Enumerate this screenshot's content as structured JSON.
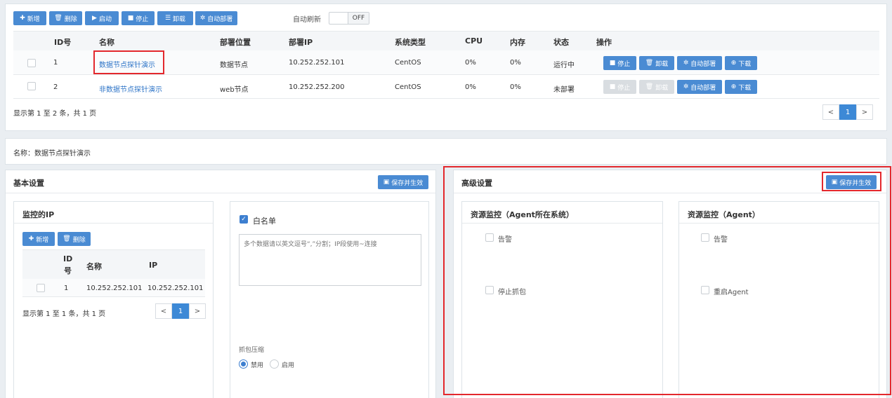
{
  "toolbar": {
    "add": "新增",
    "delete": "删除",
    "start": "启动",
    "stop": "停止",
    "uninstall": "卸载",
    "autodeploy": "自动部署",
    "autorefresh_label": "自动刷新",
    "autorefresh_state": "OFF"
  },
  "table": {
    "headers": [
      "ID号",
      "名称",
      "部署位置",
      "部署IP",
      "系统类型",
      "CPU",
      "内存",
      "状态",
      "操作"
    ],
    "rows": [
      {
        "id": "1",
        "name": "数据节点探针演示",
        "location": "数据节点",
        "ip": "10.252.252.101",
        "os": "CentOS",
        "cpu": "0%",
        "mem": "0%",
        "status": "运行中"
      },
      {
        "id": "2",
        "name": "非数据节点探针演示",
        "location": "web节点",
        "ip": "10.252.252.200",
        "os": "CentOS",
        "cpu": "0%",
        "mem": "0%",
        "status": "未部署"
      }
    ],
    "actions": {
      "stop": "停止",
      "uninstall": "卸载",
      "autodeploy": "自动部署",
      "download": "下载"
    },
    "footer": "显示第 1 至 2 条，共 1 页",
    "pager": {
      "prev": "<",
      "page": "1",
      "next": ">"
    }
  },
  "name_bar": "名称：数据节点探针演示",
  "basic": {
    "title": "基本设置",
    "save": "保存并生效",
    "monitor_ip": {
      "title": "监控的IP",
      "add": "新增",
      "delete": "删除",
      "headers": {
        "id_a": "ID",
        "id_b": "号",
        "name": "名称",
        "ip": "IP"
      },
      "row": {
        "id": "1",
        "name": "10.252.252.101",
        "ip": "10.252.252.101"
      },
      "footer": "显示第 1 至 1 条，共 1 页",
      "pager": {
        "prev": "<",
        "page": "1",
        "next": ">"
      }
    },
    "whitelist_label": "白名单",
    "whitelist_placeholder": "多个数据请以英文逗号“,”分割；IP段使用~连接",
    "compress_label": "抓包压缩",
    "compress_disable": "禁用",
    "compress_enable": "启用"
  },
  "advanced": {
    "title": "高级设置",
    "save": "保存并生效",
    "left": {
      "title": "资源监控（Agent所在系统）",
      "alarm": "告警",
      "stop_capture": "停止抓包"
    },
    "right": {
      "title": "资源监控（Agent）",
      "alarm": "告警",
      "restart": "重启Agent"
    }
  }
}
